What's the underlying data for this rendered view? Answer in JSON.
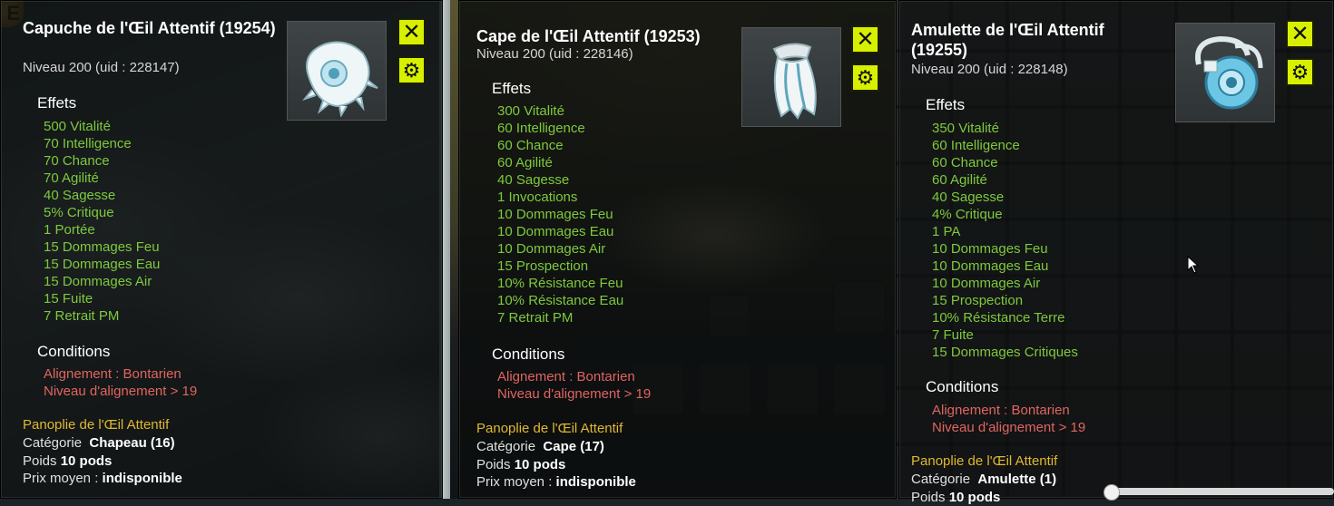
{
  "colors": {
    "effect_green": "#7ec93d",
    "condition_red": "#e06560",
    "set_gold": "#e0b830",
    "button_yellow": "#d7f000"
  },
  "corner_badge": "E",
  "items": [
    {
      "name": "Capuche de l'Œil Attentif (19254)",
      "level": "Niveau  200 (uid : 228147)",
      "icon": "hood-icon",
      "effects_title": "Effets",
      "effects": [
        "500 Vitalité",
        "70 Intelligence",
        "70 Chance",
        "70 Agilité",
        "40 Sagesse",
        "5% Critique",
        "1 Portée",
        "15 Dommages Feu",
        "15 Dommages Eau",
        "15 Dommages Air",
        "15 Fuite",
        "7 Retrait PM"
      ],
      "conditions_title": "Conditions",
      "conditions": [
        "Alignement : Bontarien",
        "Niveau d'alignement > 19"
      ],
      "set": "Panoplie de l'Œil Attentif",
      "category_label": "Catégorie",
      "category": "Chapeau (16)",
      "weight_label": "Poids",
      "weight": "10 pods",
      "price_label": "Prix moyen :",
      "price": "indisponible"
    },
    {
      "name": "Cape de l'Œil Attentif (19253)",
      "level": "Niveau  200 (uid : 228146)",
      "icon": "cape-icon",
      "effects_title": "Effets",
      "effects": [
        "300 Vitalité",
        "60 Intelligence",
        "60 Chance",
        "60 Agilité",
        "40 Sagesse",
        "1 Invocations",
        "10 Dommages Feu",
        "10 Dommages Eau",
        "10 Dommages Air",
        "15 Prospection",
        "10% Résistance Feu",
        "10% Résistance Eau",
        "7 Retrait PM"
      ],
      "conditions_title": "Conditions",
      "conditions": [
        "Alignement : Bontarien",
        "Niveau d'alignement > 19"
      ],
      "set": "Panoplie de l'Œil Attentif",
      "category_label": "Catégorie",
      "category": "Cape (17)",
      "weight_label": "Poids",
      "weight": "10 pods",
      "price_label": "Prix moyen :",
      "price": "indisponible"
    },
    {
      "name": "Amulette de l'Œil Attentif (19255)",
      "level": "Niveau  200 (uid : 228148)",
      "icon": "amulet-icon",
      "effects_title": "Effets",
      "effects": [
        "350 Vitalité",
        "60 Intelligence",
        "60 Chance",
        "60 Agilité",
        "40 Sagesse",
        "4% Critique",
        "1 PA",
        "10 Dommages Feu",
        "10 Dommages Eau",
        "10 Dommages Air",
        "15 Prospection",
        "10% Résistance Terre",
        "7 Fuite",
        "15 Dommages Critiques"
      ],
      "conditions_title": "Conditions",
      "conditions": [
        "Alignement : Bontarien",
        "Niveau d'alignement > 19"
      ],
      "set": "Panoplie de l'Œil Attentif",
      "category_label": "Catégorie",
      "category": "Amulette (1)",
      "weight_label": "Poids",
      "weight": "10 pods"
    }
  ],
  "buttons": {
    "close": "✕",
    "settings": "⚙"
  }
}
